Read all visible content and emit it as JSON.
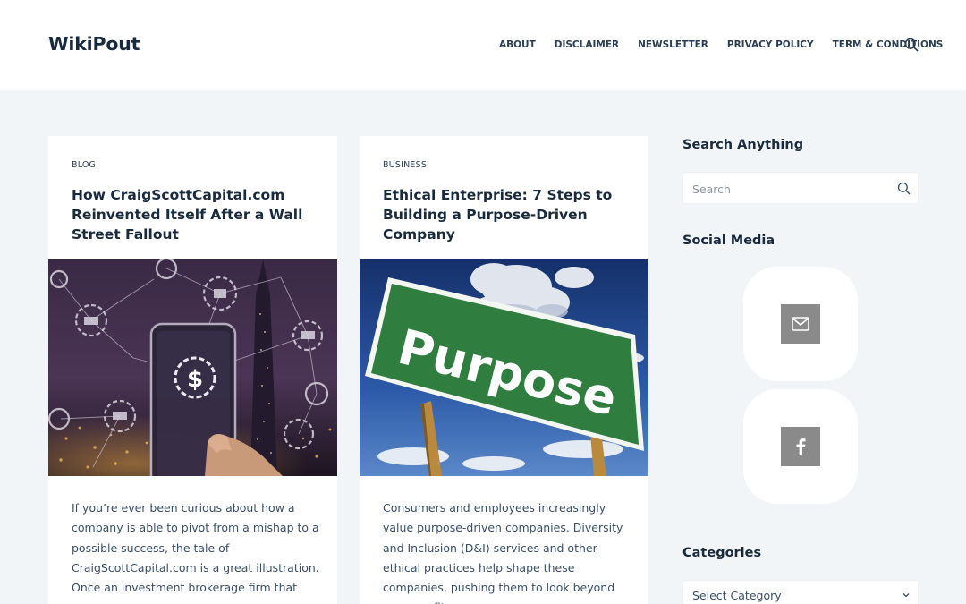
{
  "site": {
    "logo": "WikiPout"
  },
  "nav": {
    "items": [
      "ABOUT",
      "DISCLAIMER",
      "NEWSLETTER",
      "PRIVACY POLICY",
      "TERM & CONDITIONS"
    ],
    "search_icon": "search-icon"
  },
  "posts": [
    {
      "category": "BLOG",
      "title": "How CraigScottCapital.com Reinvented Itself After a Wall Street Fallout",
      "image": "smartphone-finance-network-city-image",
      "excerpt": "If you’re ever been curious about how a company is able to pivot from a mishap to a possible success, the tale of CraigScottCapital.com is a great illustration. Once an investment brokerage firm that was"
    },
    {
      "category": "BUSINESS",
      "title": "Ethical Enterprise: 7 Steps to Building a Purpose-Driven Company",
      "image": "purpose-road-sign-image",
      "image_text": "Purpose",
      "excerpt": "Consumers and employees increasingly value purpose-driven companies. Diversity and Inclusion (D&I) services and other ethical practices help shape these companies, pushing them to look beyond mere profit"
    }
  ],
  "sidebar": {
    "search": {
      "title": "Search Anything",
      "placeholder": "Search",
      "icon": "search-icon"
    },
    "social": {
      "title": "Social Media",
      "items": [
        "mail-icon",
        "facebook-icon"
      ]
    },
    "categories": {
      "title": "Categories",
      "selected": "Select Category",
      "icon": "chevron-down-icon"
    }
  },
  "colors": {
    "heading": "#192a3d",
    "text": "#3a4f66",
    "background": "#f2f5f7",
    "card": "#ffffff",
    "social_button": "#8a8a8a",
    "sign_green": "#2f7d3f"
  }
}
